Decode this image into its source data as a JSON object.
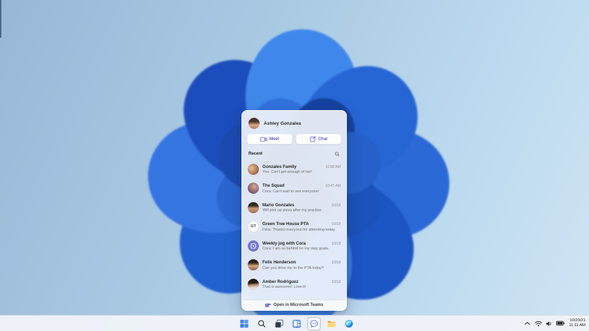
{
  "colors": {
    "teams_accent": "#5b5fc7",
    "teams_purple": "#5059c9",
    "wallpaper_sky": "#aecde6",
    "bloom_blue": "#2e6fdd",
    "taskbar_bg": "#eff3f8"
  },
  "flyout": {
    "header": {
      "user_name": "Ashley Gonzales"
    },
    "actions": {
      "meet_label": "Meet",
      "chat_label": "Chat"
    },
    "recent_label": "Recent",
    "icons": [
      "video-camera-icon",
      "compose-icon",
      "search-icon"
    ],
    "items": [
      {
        "name": "Gonzales Family",
        "preview": "You: Can't get enough of her!",
        "time": "11:08 AM"
      },
      {
        "name": "The Squad",
        "preview": "Cora: Can't wait to see everyone!",
        "time": "10:47 AM"
      },
      {
        "name": "Mario Gonzales",
        "preview": "Will pick up pizza after my practice.",
        "time": "10/19"
      },
      {
        "name": "Green Tree House PTA",
        "preview": "Felix: Thanks everyone for attending today.",
        "time": "10/19",
        "avatar_text": "GT"
      },
      {
        "name": "Weekly jog with Cora",
        "preview": "Cora: I am so behind on my step goals.",
        "time": "10/18"
      },
      {
        "name": "Felix Henderson",
        "preview": "Can you drive me to the PTA today?",
        "time": "10/18"
      },
      {
        "name": "Amber Rodriguez",
        "preview": "That is awesome! Love it!",
        "time": "10/18"
      }
    ],
    "footer_label": "Open in Microsoft Teams"
  },
  "taskbar": {
    "icons": [
      "start",
      "search",
      "task-view",
      "widgets",
      "chat",
      "file-explorer",
      "edge"
    ],
    "active_icon": "chat",
    "tray": {
      "icons": [
        "chevron-up",
        "wifi",
        "volume",
        "battery"
      ],
      "date": "10/20/21",
      "time": "11:11 AM"
    }
  }
}
